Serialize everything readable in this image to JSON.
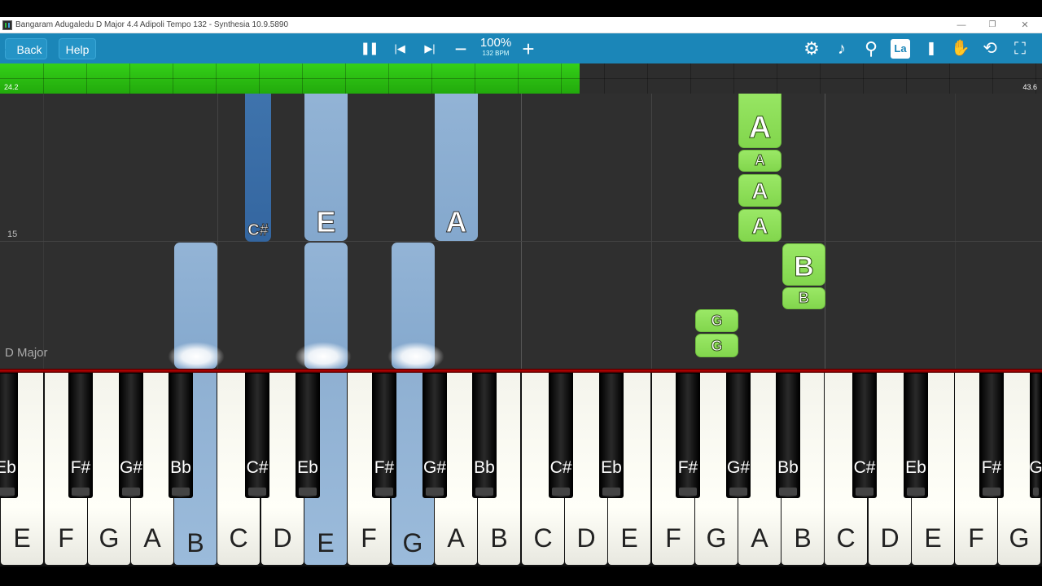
{
  "window": {
    "title": "Bangaram Adugaledu D Major 4.4 Adipoli Tempo 132 - Synthesia 10.9.5890",
    "minimize": "—",
    "maximize": "❐",
    "close": "✕"
  },
  "toolbar": {
    "back_label": "Back",
    "help_label": "Help",
    "pause_glyph": "❚❚",
    "prev_glyph": "|◀",
    "next_glyph": "▶|",
    "minus_glyph": "−",
    "plus_glyph": "+",
    "speed_percent": "100%",
    "tempo": "132 BPM",
    "settings_glyph": "⚙",
    "metronome_glyph": "♪",
    "search_glyph": "⚲",
    "label_mode": "La",
    "bookmark_glyph": "❚",
    "hand_glyph": "✋",
    "loop_glyph": "⟲",
    "fullscreen_glyph": "⛶"
  },
  "progress": {
    "fraction": 0.556,
    "start_label": "24.2",
    "end_label": "43.6"
  },
  "field": {
    "measure_number": "15",
    "key_signature": "D Major"
  },
  "notes": [
    {
      "label": "C#",
      "color": "dark-blue"
    },
    {
      "label": "E",
      "color": "blue"
    },
    {
      "label": "A",
      "color": "blue"
    },
    {
      "label": "",
      "color": "blue"
    },
    {
      "label": "",
      "color": "blue"
    },
    {
      "label": "",
      "color": "blue"
    },
    {
      "label": "A",
      "color": "green"
    },
    {
      "label": "A",
      "color": "green"
    },
    {
      "label": "A",
      "color": "green"
    },
    {
      "label": "A",
      "color": "green"
    },
    {
      "label": "B",
      "color": "green"
    },
    {
      "label": "B",
      "color": "green"
    },
    {
      "label": "G",
      "color": "green"
    },
    {
      "label": "G",
      "color": "green"
    }
  ],
  "white_keys": [
    "E",
    "F",
    "G",
    "A",
    "B",
    "C",
    "D",
    "E",
    "F",
    "G",
    "A",
    "B",
    "C",
    "D",
    "E",
    "F",
    "G",
    "A",
    "B",
    "C",
    "D",
    "E",
    "F",
    "G"
  ],
  "black_keys": [
    "Eb",
    "F#",
    "G#",
    "Bb",
    "C#",
    "Eb",
    "F#",
    "G#",
    "Bb",
    "C#",
    "Eb",
    "F#",
    "G#",
    "Bb",
    "C#",
    "Eb",
    "F#",
    "G"
  ],
  "pressed_keys": [
    "B",
    "E",
    "G"
  ],
  "colors": {
    "toolbar": "#1b86b8",
    "progress_fill": "#2ab812",
    "note_blue": "#8caed0",
    "note_dark_blue": "#3a6ea8",
    "note_green": "#8ee05a"
  }
}
